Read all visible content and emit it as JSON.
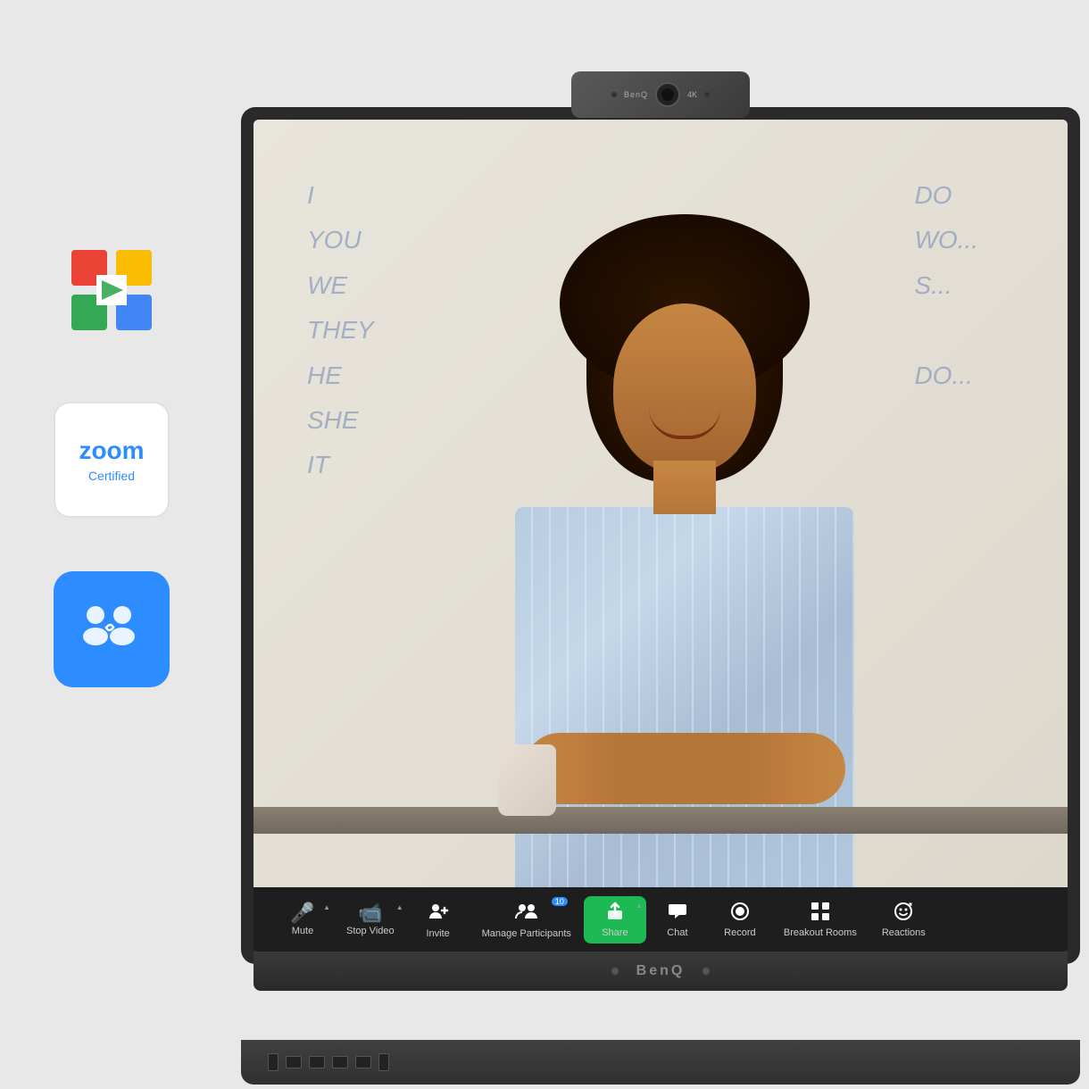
{
  "page": {
    "background": "#e8e8e8"
  },
  "logos": {
    "google_meet": {
      "alt": "Google Meet Logo"
    },
    "zoom": {
      "text": "zoom",
      "certified": "Certified",
      "alt": "Zoom Certified"
    },
    "ams": {
      "alt": "AMS Icon"
    }
  },
  "webcam": {
    "brand": "BenQ",
    "label": "4K"
  },
  "monitor": {
    "brand": "BenQ"
  },
  "whiteboard": {
    "left_text_lines": [
      "I",
      "YOU",
      "WE",
      "THEY",
      "HE",
      "SHE IT"
    ],
    "right_text_lines": [
      "DO",
      "WO...",
      "S...",
      "DO..."
    ]
  },
  "zoom_toolbar": {
    "items": [
      {
        "id": "mute",
        "icon": "🎤",
        "label": "Mute",
        "has_chevron": true
      },
      {
        "id": "stop-video",
        "icon": "📹",
        "label": "Stop Video",
        "has_chevron": true
      },
      {
        "id": "invite",
        "icon": "👤+",
        "label": "Invite",
        "has_chevron": false
      },
      {
        "id": "manage-participants",
        "icon": "👥",
        "label": "Manage Participants",
        "has_chevron": false,
        "badge": "10"
      },
      {
        "id": "share",
        "icon": "↑",
        "label": "Share",
        "has_chevron": true,
        "is_green": true
      },
      {
        "id": "chat",
        "icon": "💬",
        "label": "Chat",
        "has_chevron": false
      },
      {
        "id": "record",
        "icon": "⏺",
        "label": "Record",
        "has_chevron": false
      },
      {
        "id": "breakout-rooms",
        "icon": "⊞",
        "label": "Breakout Rooms",
        "has_chevron": false
      },
      {
        "id": "reactions",
        "icon": "☺+",
        "label": "Reactions",
        "has_chevron": false
      }
    ]
  }
}
